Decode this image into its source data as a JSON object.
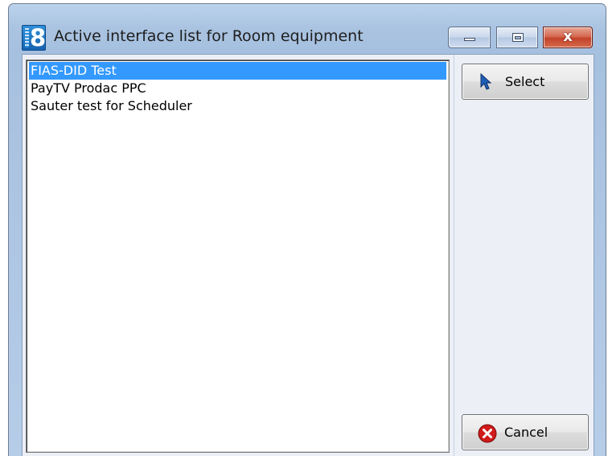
{
  "window": {
    "title": "Active interface list for Room equipment",
    "app_icon_glyph": "8",
    "controls": {
      "minimize_icon": "minimize-icon",
      "maximize_icon": "maximize-icon",
      "close_glyph": "x"
    }
  },
  "interface_list": {
    "items": [
      {
        "label": "FIAS-DID Test",
        "selected": true
      },
      {
        "label": "PayTV Prodac PPC",
        "selected": false
      },
      {
        "label": "Sauter test for Scheduler",
        "selected": false
      }
    ]
  },
  "buttons": {
    "select_label": "Select",
    "select_icon": "cursor-arrow-icon",
    "cancel_label": "Cancel",
    "cancel_icon": "cancel-x-circle-icon"
  },
  "colors": {
    "selection": "#3399ff",
    "cancel_icon": "#d11a1a"
  }
}
